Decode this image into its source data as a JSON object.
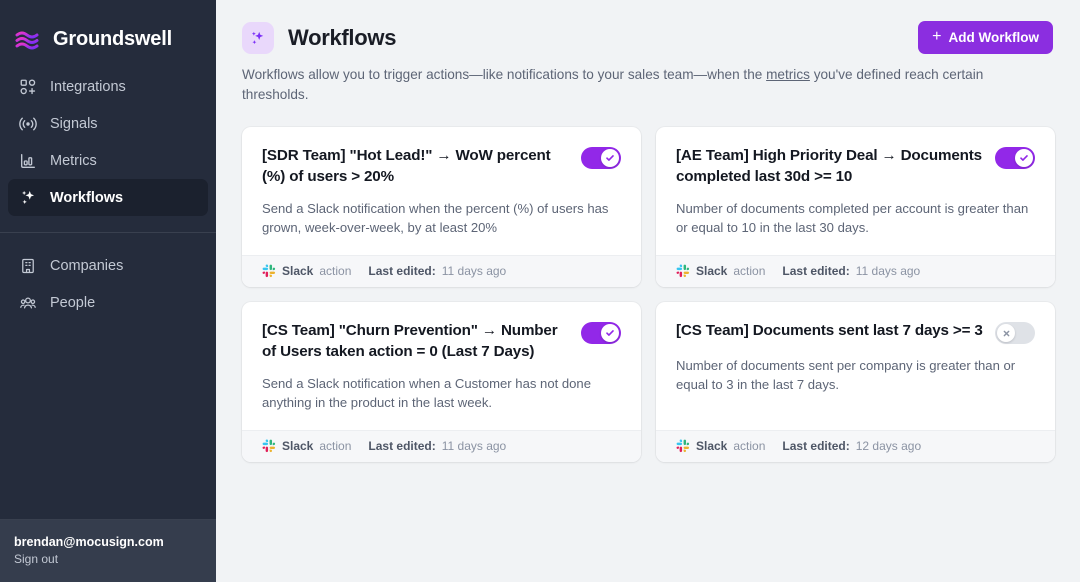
{
  "sidebar": {
    "brand": {
      "name": "Groundswell",
      "logo_icon": "waves-logo-icon"
    },
    "items": [
      {
        "label": "Integrations",
        "icon": "integrations-icon",
        "active": false
      },
      {
        "label": "Signals",
        "icon": "signal-broadcast-icon",
        "active": false
      },
      {
        "label": "Metrics",
        "icon": "bar-chart-icon",
        "active": false
      },
      {
        "label": "Workflows",
        "icon": "sparkles-icon",
        "active": true
      }
    ],
    "items_secondary": [
      {
        "label": "Companies",
        "icon": "building-icon",
        "active": false
      },
      {
        "label": "People",
        "icon": "people-icon",
        "active": false
      }
    ],
    "footer": {
      "email": "brendan@mocusign.com",
      "sign_out": "Sign out"
    }
  },
  "header": {
    "icon": "sparkles-icon",
    "title": "Workflows",
    "add_button": {
      "label": "Add Workflow",
      "icon": "plus-icon"
    },
    "description_part1": "Workflows allow you to trigger actions—like notifications to your sales team—when the ",
    "description_link": "metrics",
    "description_part2": " you've defined reach certain thresholds."
  },
  "colors": {
    "accent_purple": "#8b2ee0",
    "toggle_on": "#9228e8",
    "toggle_off": "#dfe2e7",
    "sidebar_bg": "#252c3c",
    "page_bg": "#f1f3f5"
  },
  "workflows": [
    {
      "title": "[SDR Team] \"Hot Lead!\" → WoW percent (%) of users > 20%",
      "description": "Send a Slack notification when the percent (%) of users has grown, week-over-week, by at least 20%",
      "action_name": "Slack",
      "action_suffix": "action",
      "last_edited_label": "Last edited:",
      "last_edited_value": "11 days ago",
      "enabled": true
    },
    {
      "title": "[AE Team] High Priority Deal → Documents completed last 30d >= 10",
      "description": "Number of documents completed per account is greater than or equal to 10 in the last 30 days.",
      "action_name": "Slack",
      "action_suffix": "action",
      "last_edited_label": "Last edited:",
      "last_edited_value": "11 days ago",
      "enabled": true
    },
    {
      "title": "[CS Team] \"Churn Prevention\" → Number of Users taken action = 0 (Last 7 Days)",
      "description": "Send a Slack notification when a Customer has not done anything in the product in the last week.",
      "action_name": "Slack",
      "action_suffix": "action",
      "last_edited_label": "Last edited:",
      "last_edited_value": "11 days ago",
      "enabled": true
    },
    {
      "title": "[CS Team] Documents sent last 7 days >= 3",
      "description": "Number of documents sent per company is greater than or equal to 3 in the last 7 days.",
      "action_name": "Slack",
      "action_suffix": "action",
      "last_edited_label": "Last edited:",
      "last_edited_value": "12 days ago",
      "enabled": false
    }
  ]
}
